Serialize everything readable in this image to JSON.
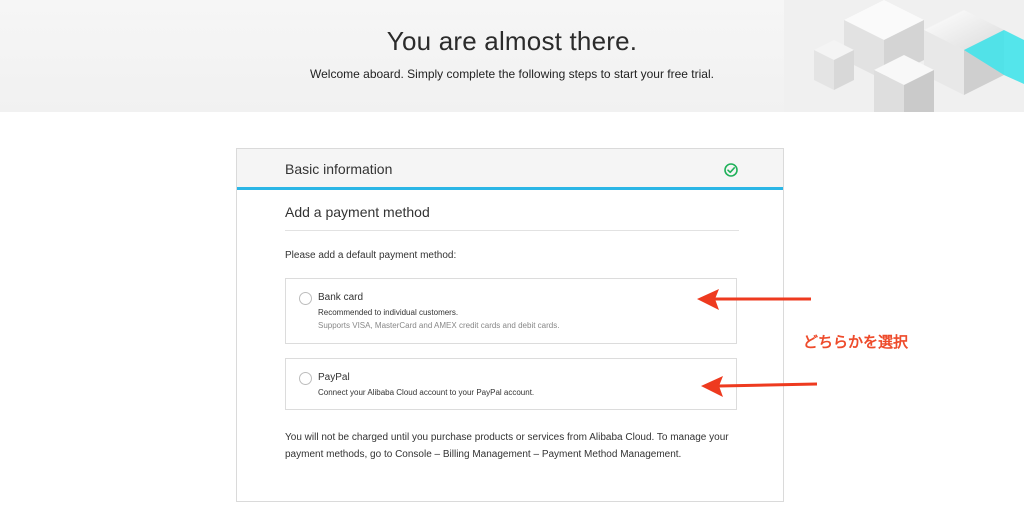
{
  "hero": {
    "title": "You are almost there.",
    "subtitle": "Welcome aboard. Simply complete the following steps to start your free trial."
  },
  "steps": {
    "basic_info": {
      "title": "Basic information",
      "status_icon": "check-circle-icon",
      "status_color": "#20b15a"
    },
    "payment": {
      "title": "Add a payment method",
      "prompt": "Please add a default payment method:",
      "options": [
        {
          "label": "Bank card",
          "description": "Recommended to individual customers.",
          "note": "Supports VISA, MasterCard and AMEX credit cards and debit cards."
        },
        {
          "label": "PayPal",
          "description": "Connect your Alibaba Cloud account to your PayPal account."
        }
      ],
      "footer": "You will not be charged until you purchase products or services from Alibaba Cloud. To manage your payment methods, go to Console – Billing Management – Payment Method Management."
    }
  },
  "annotation": {
    "text": "どちらかを選択",
    "color": "#ee4b2b"
  },
  "colors": {
    "accent": "#2bb6e6",
    "decor_cyan": "#43e3ea"
  }
}
